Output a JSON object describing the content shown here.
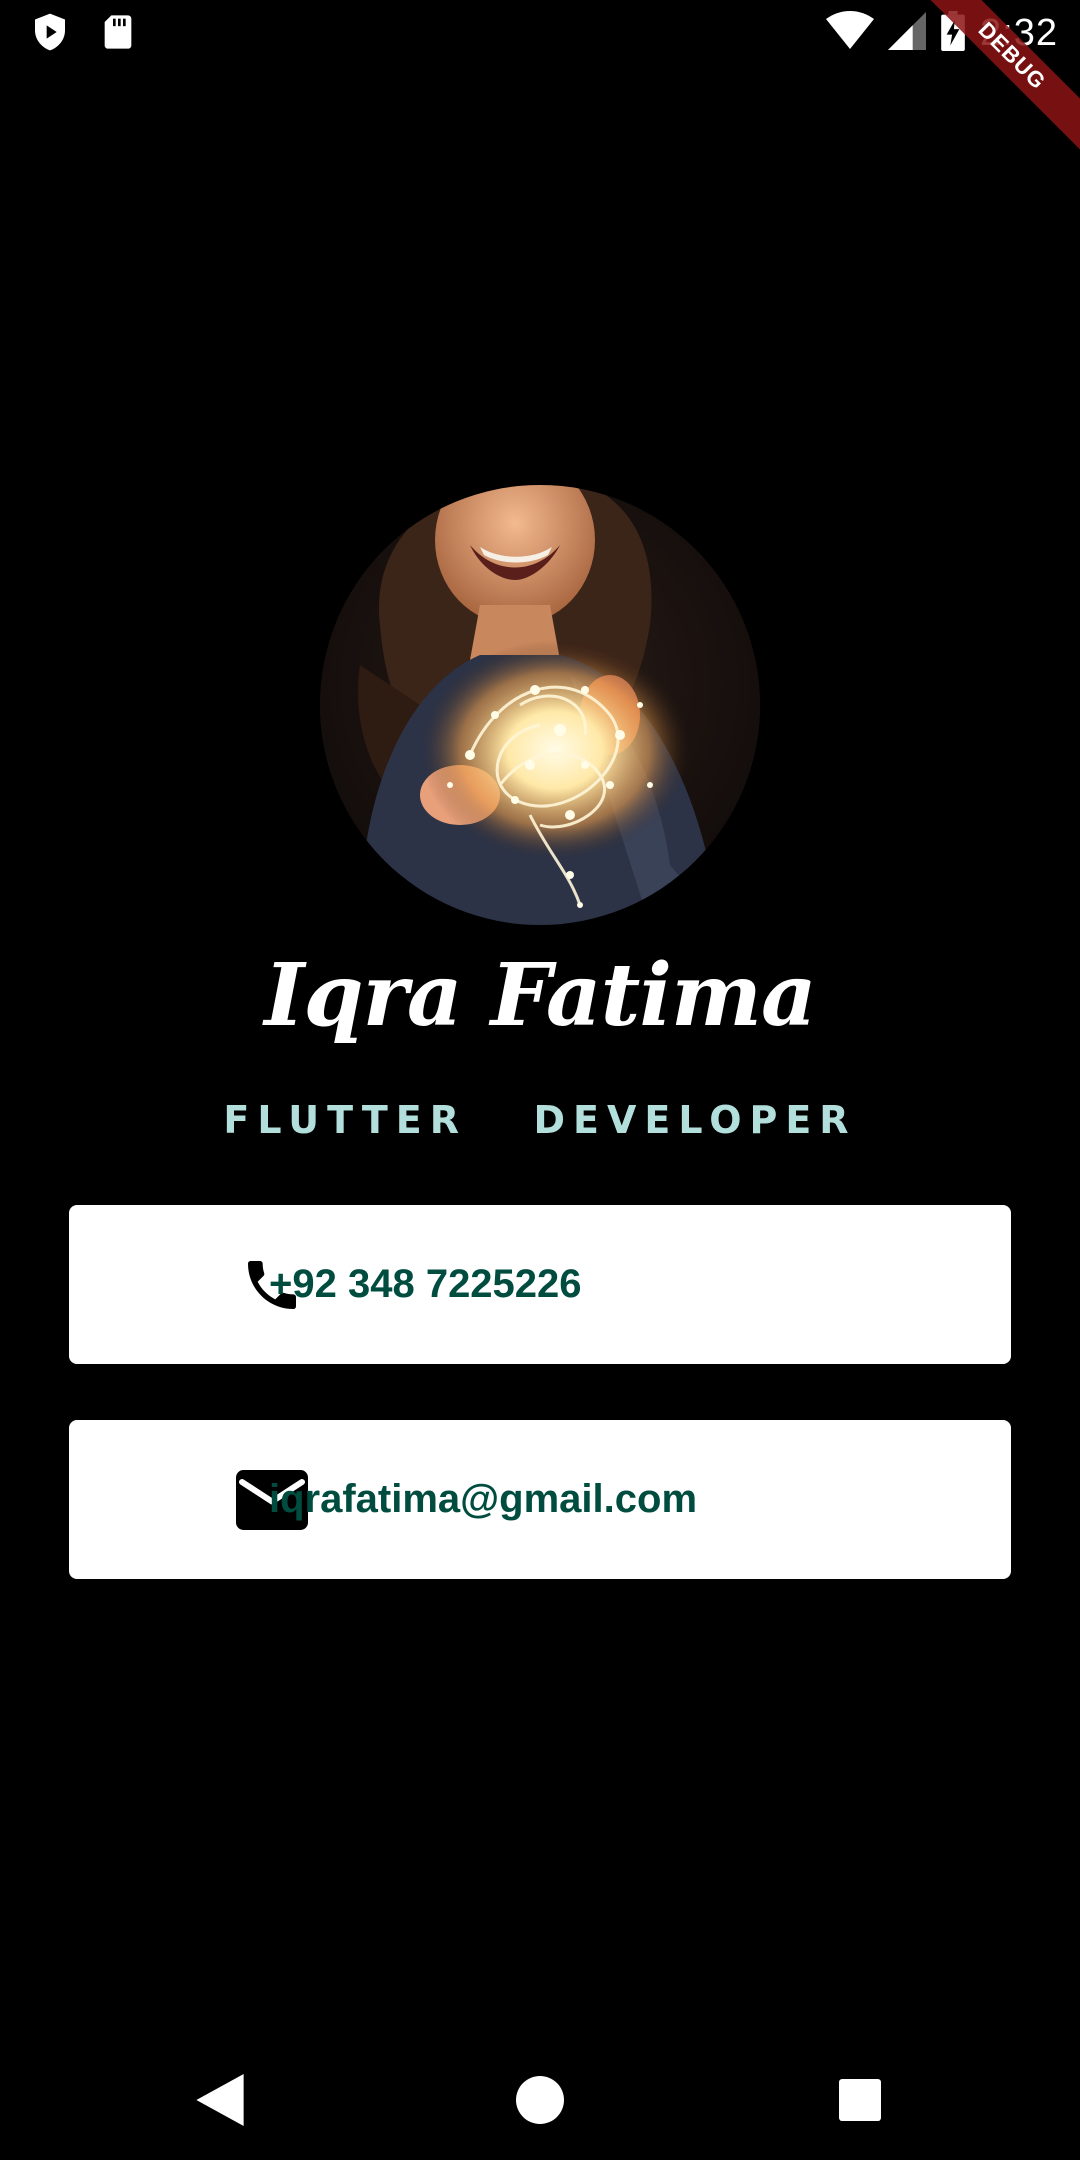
{
  "status_bar": {
    "time": "2:32",
    "icons": [
      "shield-play-icon",
      "sd-card-icon",
      "wifi-icon",
      "signal-icon",
      "battery-charging-icon"
    ]
  },
  "debug_banner": "DEBUG",
  "profile": {
    "name": "Iqra Fatima",
    "role": "FLUTTER  DEVELOPER",
    "avatar_icon": "profile-photo"
  },
  "contacts": [
    {
      "icon": "phone-icon",
      "value": "+92 348 7225226"
    },
    {
      "icon": "mail-icon",
      "value": "iqrafatima@gmail.com"
    }
  ],
  "nav": {
    "icons": [
      "back-icon",
      "home-icon",
      "recents-icon"
    ]
  },
  "colors": {
    "background": "#000000",
    "role_text": "#b2dfdb",
    "card_background": "#ffffff",
    "card_text": "#004d40",
    "debug_ribbon": "#8c1414"
  }
}
